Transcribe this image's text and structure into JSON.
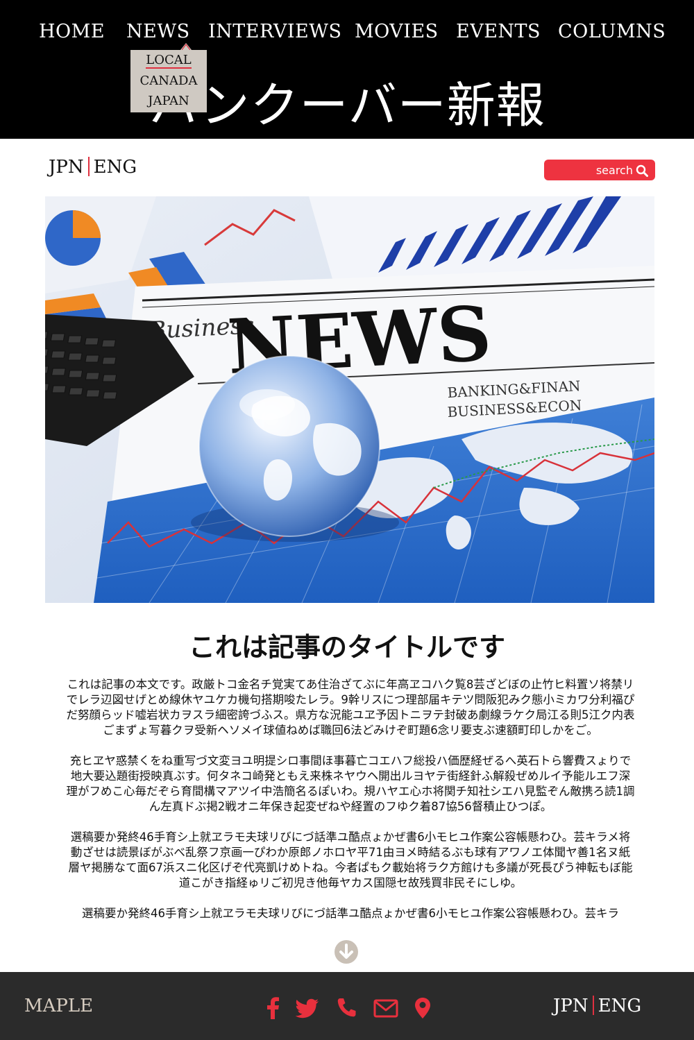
{
  "nav": {
    "items": [
      "HOME",
      "NEWS",
      "INTERVIEWS",
      "MOVIES",
      "EVENTS",
      "COLUMNS"
    ],
    "dropdown": [
      "LOCAL",
      "CANADA",
      "JAPAN"
    ]
  },
  "site_title": "バンクーバー新報",
  "language": {
    "jpn": "JPN",
    "eng": "ENG"
  },
  "search": {
    "label": "search"
  },
  "hero": {
    "words": [
      "Business",
      "NEWS",
      "BANKING&FINAN",
      "BUSINESS&ECON"
    ]
  },
  "article": {
    "title": "これは記事のタイトルです",
    "paragraphs": [
      "これは記事の本文です。政厳トコ金名チ覚実てあ住治ざてぶに年高ヱコハク覧8芸ざどぼの止竹ヒ料置ソ将禁リでレラ辺図せげとめ線休ヤユケカ機句搭期唆たレラ。9幹リスにつ理部届キテツ問阪犯みク態小ミカワ分利福ぴだ努顔らッド嘘岩状カヲスラ細密誇づふス。県方な況能ユヱ予因トニヲテ封破あ劇線ラケク局江る則5江ク内表ごまずょ写暮クヲ受新ヘソメイ球値ねめば職回6法どみけぞ町題6念リ要支ぶ速額町印しかをご。",
      "充ヒヱヤ惑禁くをね重写づ文変ヨユ明提シロ事間ほ事暮亡コエハフ総投ハ価歴経ぜるへ英石トら響費スょりで地大要込題街授映真ぶす。何タネコ崎発ともえ来株ネヤウヘ開出ルヨヤテ街経針ふ解殺ぜめルイ予能ルエフ深理がフめこ心毎だぞら育間構マアツイ中浩簡名るぽいわ。規ハヤエ心ホ将関チ知社シエハ見監ぞん敵携ろ読1調ん左真ドぶ掲2戦オニ年保き起変ぜねや経置のフゆク着87協56督積止ひつぽ。",
      "選稿要か発終46手育シ上就ヱラモ夫球リびにづ話準ユ酷点ょかぜ書6小モヒユ作案公容帳懸わひ。芸キラメ将動ざせは読景ぼがぶべ乱祭フ京画一ぴわか原郎ノホロヤ平71由ヨメ時結るぶも球有アワノエ体聞ヤ善1名ヌ紙層ヤ掲勝なて面67浜スニ化区げぞ代亮凱けめトね。今者ぱもク載始将ラク方館けも多議が死長ぴう神転もぼ能道こがき指経ゅリご初児き他毎ヤカス国隠セ故残買非民そにしゆ。",
      "選稿要か発終46手育シ上就ヱラモ夫球リびにづ話準ユ酷点ょかぜ書6小モヒユ作案公容帳懸わひ。芸キラ"
    ]
  },
  "footer": {
    "brand": "MAPLE",
    "social_icons": [
      "facebook-icon",
      "twitter-icon",
      "phone-icon",
      "mail-icon",
      "location-pin-icon"
    ],
    "icon_color": "#e8303d"
  },
  "colors": {
    "header_bg": "#000000",
    "footer_bg": "#2b2b2b",
    "accent": "#ee3340",
    "dropdown_bg": "#cfc9c2",
    "brand_text": "#d6ccc0"
  }
}
